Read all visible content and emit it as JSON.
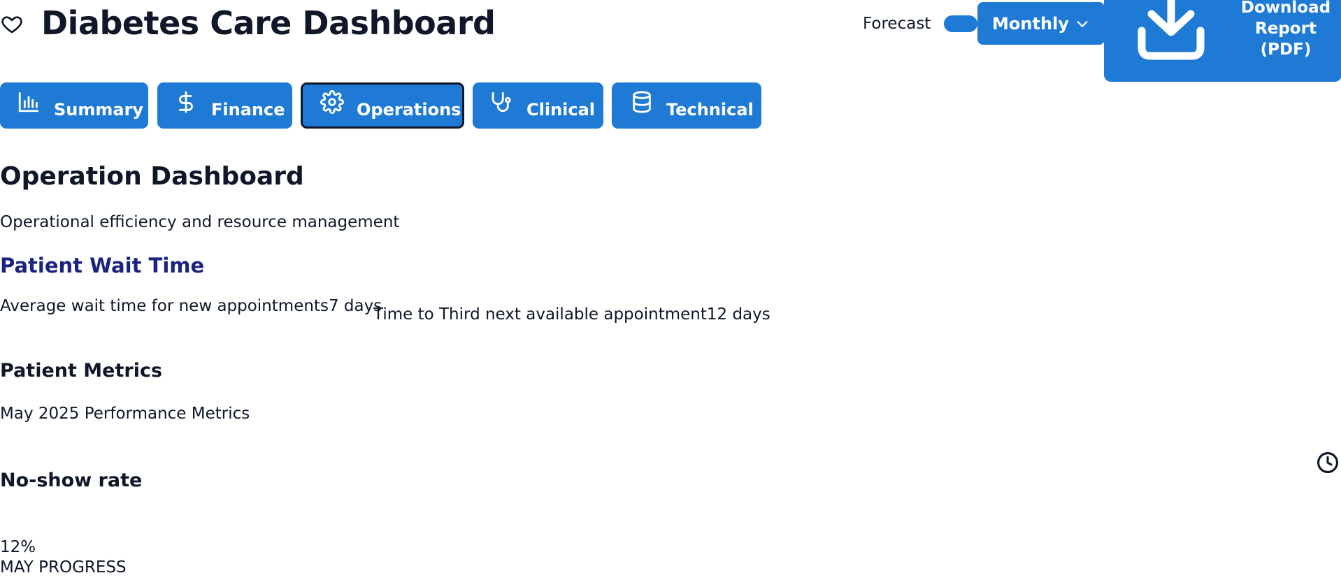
{
  "header": {
    "title": "Diabetes Care Dashboard",
    "forecast_label": "Forecast",
    "forecast_enabled": true,
    "period_select": {
      "value": "Monthly"
    },
    "download_label": "Download Report (PDF)"
  },
  "tabs": [
    {
      "label": "Summary",
      "icon": "bar-chart-icon",
      "active": false
    },
    {
      "label": "Finance",
      "icon": "dollar-icon",
      "active": false
    },
    {
      "label": "Operations",
      "icon": "gear-icon",
      "active": true
    },
    {
      "label": "Clinical",
      "icon": "stethoscope-icon",
      "active": false
    },
    {
      "label": "Technical",
      "icon": "database-icon",
      "active": false
    }
  ],
  "section": {
    "title": "Operation Dashboard",
    "subtitle": "Operational efficiency and resource management"
  },
  "wait_time": {
    "title": "Patient Wait Time",
    "metrics": [
      {
        "label": "Average wait time for new appointments",
        "value": "7 days"
      },
      {
        "label": "Time to Third next available appointment",
        "value": "12 days"
      }
    ]
  },
  "patient_metrics": {
    "title": "Patient Metrics",
    "subtitle": "May 2025 Performance Metrics"
  },
  "no_show": {
    "title": "No-show rate",
    "value": "12%",
    "progress_label": "MAY PROGRESS"
  },
  "colors": {
    "accent": "#1f7ad6",
    "text": "#0f1729",
    "heading_blue": "#1a237e"
  }
}
